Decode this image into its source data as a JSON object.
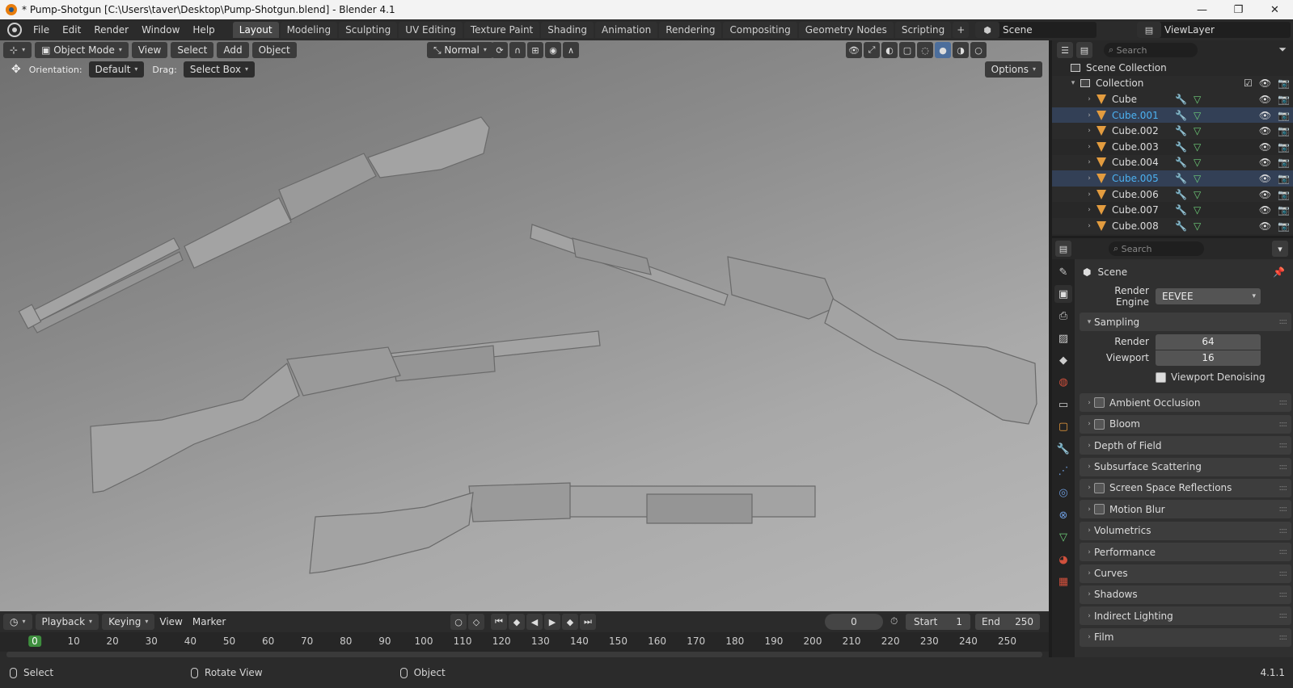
{
  "window": {
    "title": "* Pump-Shotgun [C:\\Users\\taver\\Desktop\\Pump-Shotgun.blend] - Blender 4.1",
    "minimize": "—",
    "maximize": "❐",
    "close": "✕"
  },
  "menu": [
    "File",
    "Edit",
    "Render",
    "Window",
    "Help"
  ],
  "workspaces": [
    "Layout",
    "Modeling",
    "Sculpting",
    "UV Editing",
    "Texture Paint",
    "Shading",
    "Animation",
    "Rendering",
    "Compositing",
    "Geometry Nodes",
    "Scripting"
  ],
  "active_workspace": "Layout",
  "scene_selector": "Scene",
  "viewlayer_selector": "ViewLayer",
  "viewport": {
    "mode": "Object Mode",
    "menus": [
      "View",
      "Select",
      "Add",
      "Object"
    ],
    "transform_orientation": "Normal",
    "orientation_label": "Orientation:",
    "orientation_value": "Default",
    "drag_label": "Drag:",
    "drag_value": "Select Box",
    "options": "Options"
  },
  "outliner": {
    "search_placeholder": "Search",
    "scene_collection": "Scene Collection",
    "collection": "Collection",
    "objects": [
      {
        "name": "Cube",
        "highlight": false
      },
      {
        "name": "Cube.001",
        "highlight": true
      },
      {
        "name": "Cube.002",
        "highlight": false
      },
      {
        "name": "Cube.003",
        "highlight": false
      },
      {
        "name": "Cube.004",
        "highlight": false
      },
      {
        "name": "Cube.005",
        "highlight": true
      },
      {
        "name": "Cube.006",
        "highlight": false
      },
      {
        "name": "Cube.007",
        "highlight": false
      },
      {
        "name": "Cube.008",
        "highlight": false
      }
    ]
  },
  "properties": {
    "search_placeholder": "Search",
    "context": "Scene",
    "render_engine_label": "Render Engine",
    "render_engine": "EEVEE",
    "sampling": "Sampling",
    "render_label": "Render",
    "render_value": "64",
    "viewport_label": "Viewport",
    "viewport_value": "16",
    "viewport_denoising": "Viewport Denoising",
    "panels": [
      {
        "label": "Ambient Occlusion",
        "checkbox": true
      },
      {
        "label": "Bloom",
        "checkbox": true
      },
      {
        "label": "Depth of Field",
        "checkbox": false
      },
      {
        "label": "Subsurface Scattering",
        "checkbox": false
      },
      {
        "label": "Screen Space Reflections",
        "checkbox": true
      },
      {
        "label": "Motion Blur",
        "checkbox": true
      },
      {
        "label": "Volumetrics",
        "checkbox": false
      },
      {
        "label": "Performance",
        "checkbox": false
      },
      {
        "label": "Curves",
        "checkbox": false
      },
      {
        "label": "Shadows",
        "checkbox": false
      },
      {
        "label": "Indirect Lighting",
        "checkbox": false
      },
      {
        "label": "Film",
        "checkbox": false
      }
    ]
  },
  "timeline": {
    "playback": "Playback",
    "keying": "Keying",
    "view": "View",
    "marker": "Marker",
    "current_frame": "0",
    "start_label": "Start",
    "start": "1",
    "end_label": "End",
    "end": "250",
    "ruler": [
      "0",
      "10",
      "20",
      "30",
      "40",
      "50",
      "60",
      "70",
      "80",
      "90",
      "100",
      "110",
      "120",
      "130",
      "140",
      "150",
      "160",
      "170",
      "180",
      "190",
      "200",
      "210",
      "220",
      "230",
      "240",
      "250"
    ]
  },
  "statusbar": {
    "select": "Select",
    "rotate": "Rotate View",
    "object": "Object",
    "version": "4.1.1"
  }
}
